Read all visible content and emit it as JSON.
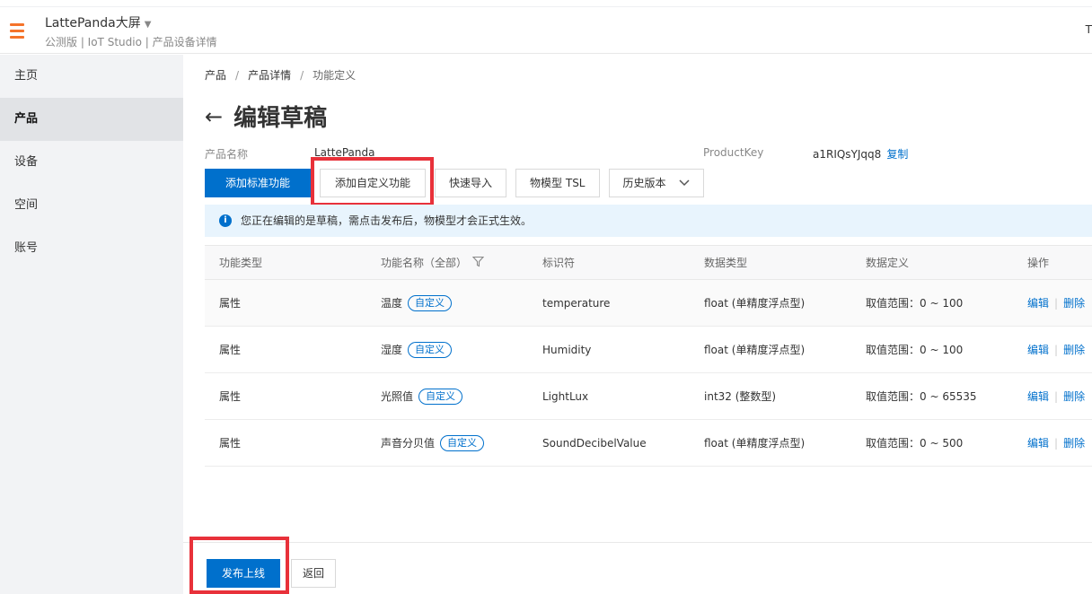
{
  "header": {
    "app_name": "LattePanda大屏",
    "app_sub": "公测版 | IoT Studio | 产品设备详情",
    "right_text": "T"
  },
  "sidebar": {
    "items": [
      {
        "label": "主页"
      },
      {
        "label": "产品"
      },
      {
        "label": "设备"
      },
      {
        "label": "空间"
      },
      {
        "label": "账号"
      }
    ]
  },
  "breadcrumb": [
    "产品",
    "产品详情",
    "功能定义"
  ],
  "page_title": "编辑草稿",
  "meta": {
    "product_name_label": "产品名称",
    "product_name_value": "LattePanda",
    "product_key_label": "ProductKey",
    "product_key_value": "a1RIQsYJqq8",
    "copy_label": "复制"
  },
  "toolbar": {
    "add_standard": "添加标准功能",
    "add_custom": "添加自定义功能",
    "quick_import": "快速导入",
    "tsl": "物模型 TSL",
    "history": "历史版本"
  },
  "notice": "您正在编辑的是草稿，需点击发布后，物模型才会正式生效。",
  "table": {
    "headers": [
      "功能类型",
      "功能名称（全部）",
      "标识符",
      "数据类型",
      "数据定义",
      "操作"
    ],
    "rows": [
      {
        "type": "属性",
        "name": "温度",
        "tag": "自定义",
        "identifier": "temperature",
        "data_type": "float (单精度浮点型)",
        "definition": "取值范围：0 ~ 100",
        "edit": "编辑",
        "delete": "删除"
      },
      {
        "type": "属性",
        "name": "湿度",
        "tag": "自定义",
        "identifier": "Humidity",
        "data_type": "float (单精度浮点型)",
        "definition": "取值范围：0 ~ 100",
        "edit": "编辑",
        "delete": "删除"
      },
      {
        "type": "属性",
        "name": "光照值",
        "tag": "自定义",
        "identifier": "LightLux",
        "data_type": "int32 (整数型)",
        "definition": "取值范围：0 ~ 65535",
        "edit": "编辑",
        "delete": "删除"
      },
      {
        "type": "属性",
        "name": "声音分贝值",
        "tag": "自定义",
        "identifier": "SoundDecibelValue",
        "data_type": "float (单精度浮点型)",
        "definition": "取值范围：0 ~ 500",
        "edit": "编辑",
        "delete": "删除"
      }
    ]
  },
  "footer": {
    "publish": "发布上线",
    "back": "返回"
  },
  "colors": {
    "primary": "#0070cc",
    "accent": "#f5732a",
    "highlight": "#e8313a",
    "notice_bg": "#e8f4fd"
  }
}
